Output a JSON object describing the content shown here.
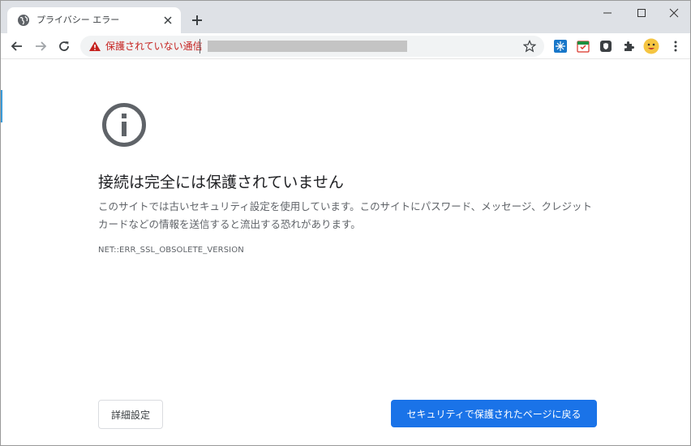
{
  "tab": {
    "title": "プライバシー エラー",
    "favicon": "globe-icon"
  },
  "omnibox": {
    "security_label": "保護されていない通信",
    "warning_color": "#c5221f"
  },
  "extensions": [
    "snowflake-extension-icon",
    "calendar-extension-icon",
    "shield-extension-icon",
    "puzzle-icon",
    "profile-avatar"
  ],
  "error": {
    "heading": "接続は完全には保護されていません",
    "description": "このサイトでは古いセキュリティ設定を使用しています。このサイトにパスワード、メッセージ、クレジット カードなどの情報を送信すると流出する恐れがあります。",
    "code": "NET::ERR_SSL_OBSOLETE_VERSION"
  },
  "buttons": {
    "details": "詳細設定",
    "back_to_safety": "セキュリティで保護されたページに戻る"
  },
  "colors": {
    "accent": "#1a73e8",
    "tabstrip": "#dee1e6"
  }
}
